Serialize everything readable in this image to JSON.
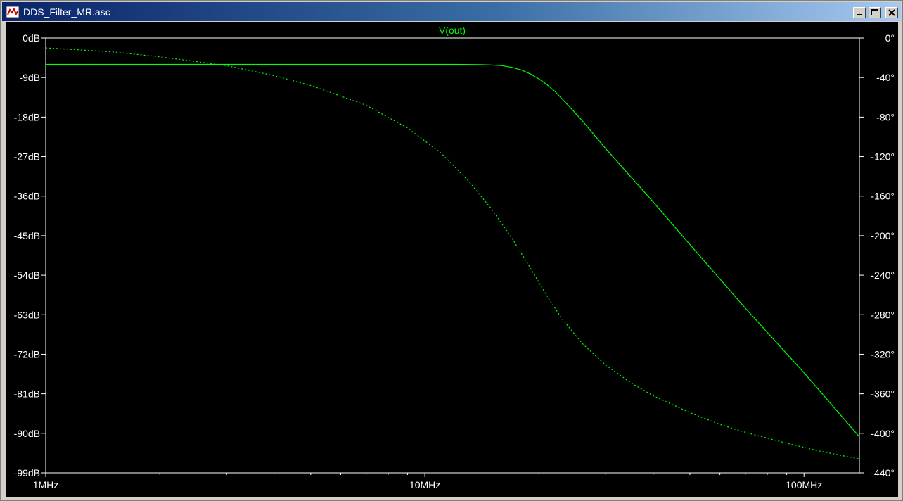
{
  "window": {
    "title": "DDS_Filter_MR.asc"
  },
  "colors": {
    "trace": "#00ff00",
    "axis": "#ffffff",
    "background": "#000000"
  },
  "chart_data": {
    "type": "line",
    "title": "V(out)",
    "x_scale": "log",
    "xlim_hz": [
      1000000,
      140000000
    ],
    "x_tick_values_hz": [
      1000000,
      10000000,
      100000000
    ],
    "x_tick_labels": [
      "1MHz",
      "10MHz",
      "100MHz"
    ],
    "y_left": {
      "ylim": [
        -99,
        0
      ],
      "tick_labels": [
        "0dB",
        "-9dB",
        "-18dB",
        "-27dB",
        "-36dB",
        "-45dB",
        "-54dB",
        "-63dB",
        "-72dB",
        "-81dB",
        "-90dB",
        "-99dB"
      ]
    },
    "y_right": {
      "ylim": [
        -440,
        0
      ],
      "tick_labels": [
        "0°",
        "-40°",
        "-80°",
        "-120°",
        "-160°",
        "-200°",
        "-240°",
        "-280°",
        "-320°",
        "-360°",
        "-400°",
        "-440°"
      ]
    },
    "grid": false,
    "series": [
      {
        "name": "V(out)",
        "quantity": "magnitude_dB",
        "axis": "left",
        "style": "solid",
        "x_hz": [
          1000000,
          2000000,
          5000000,
          10000000,
          12000000,
          14000000,
          15000000,
          16000000,
          17000000,
          18000000,
          19000000,
          20000000,
          21000000,
          22000000,
          24000000,
          26000000,
          30000000,
          40000000,
          50000000,
          70000000,
          100000000,
          140000000
        ],
        "values": [
          -6.0,
          -6.0,
          -6.0,
          -6.0,
          -6.0,
          -6.05,
          -6.15,
          -6.3,
          -6.7,
          -7.3,
          -8.2,
          -9.3,
          -10.6,
          -12.1,
          -15.5,
          -18.8,
          -25.2,
          -37.3,
          -47.0,
          -61.5,
          -76.2,
          -90.8
        ]
      },
      {
        "name": "V(out)",
        "quantity": "phase_deg",
        "axis": "right",
        "style": "dashed",
        "x_hz": [
          1000000,
          1500000,
          2000000,
          3000000,
          4000000,
          5000000,
          7000000,
          9000000,
          11000000,
          13000000,
          15000000,
          17000000,
          19000000,
          21000000,
          23000000,
          26000000,
          30000000,
          35000000,
          40000000,
          50000000,
          60000000,
          70000000,
          90000000,
          110000000,
          140000000
        ],
        "values": [
          -10,
          -14,
          -19,
          -28,
          -38,
          -48,
          -68,
          -91,
          -116,
          -144,
          -173,
          -203,
          -233,
          -261,
          -284,
          -309,
          -331,
          -349,
          -362,
          -379,
          -391,
          -399,
          -410,
          -418,
          -426
        ]
      }
    ]
  }
}
